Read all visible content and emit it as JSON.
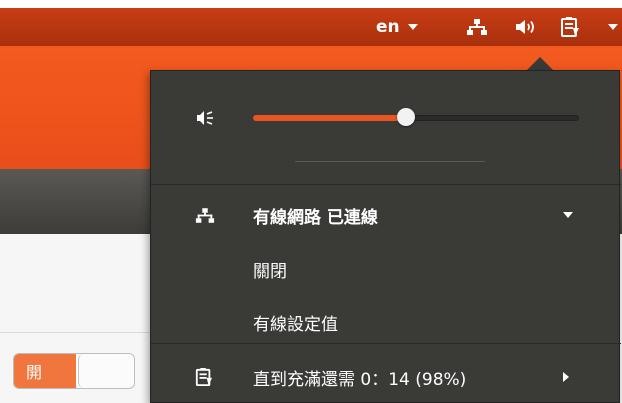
{
  "panel": {
    "language": "en",
    "icons": [
      "network-wired-icon",
      "volume-icon",
      "battery-icon"
    ]
  },
  "app": {
    "toggle_label": "開"
  },
  "menu": {
    "volume": {
      "level": 0.47,
      "icon": "volume-low-icon"
    },
    "network": {
      "title": "有線網路 已連線",
      "turn_off": "關閉",
      "settings": "有線設定值"
    },
    "battery": {
      "status": "直到充滿還需 0：14 (98%)"
    }
  },
  "colors": {
    "accent": "#e95420",
    "menu_bg": "#3a3a37",
    "panel_bg": "#b3330f",
    "toggle_on": "#f1763e"
  }
}
